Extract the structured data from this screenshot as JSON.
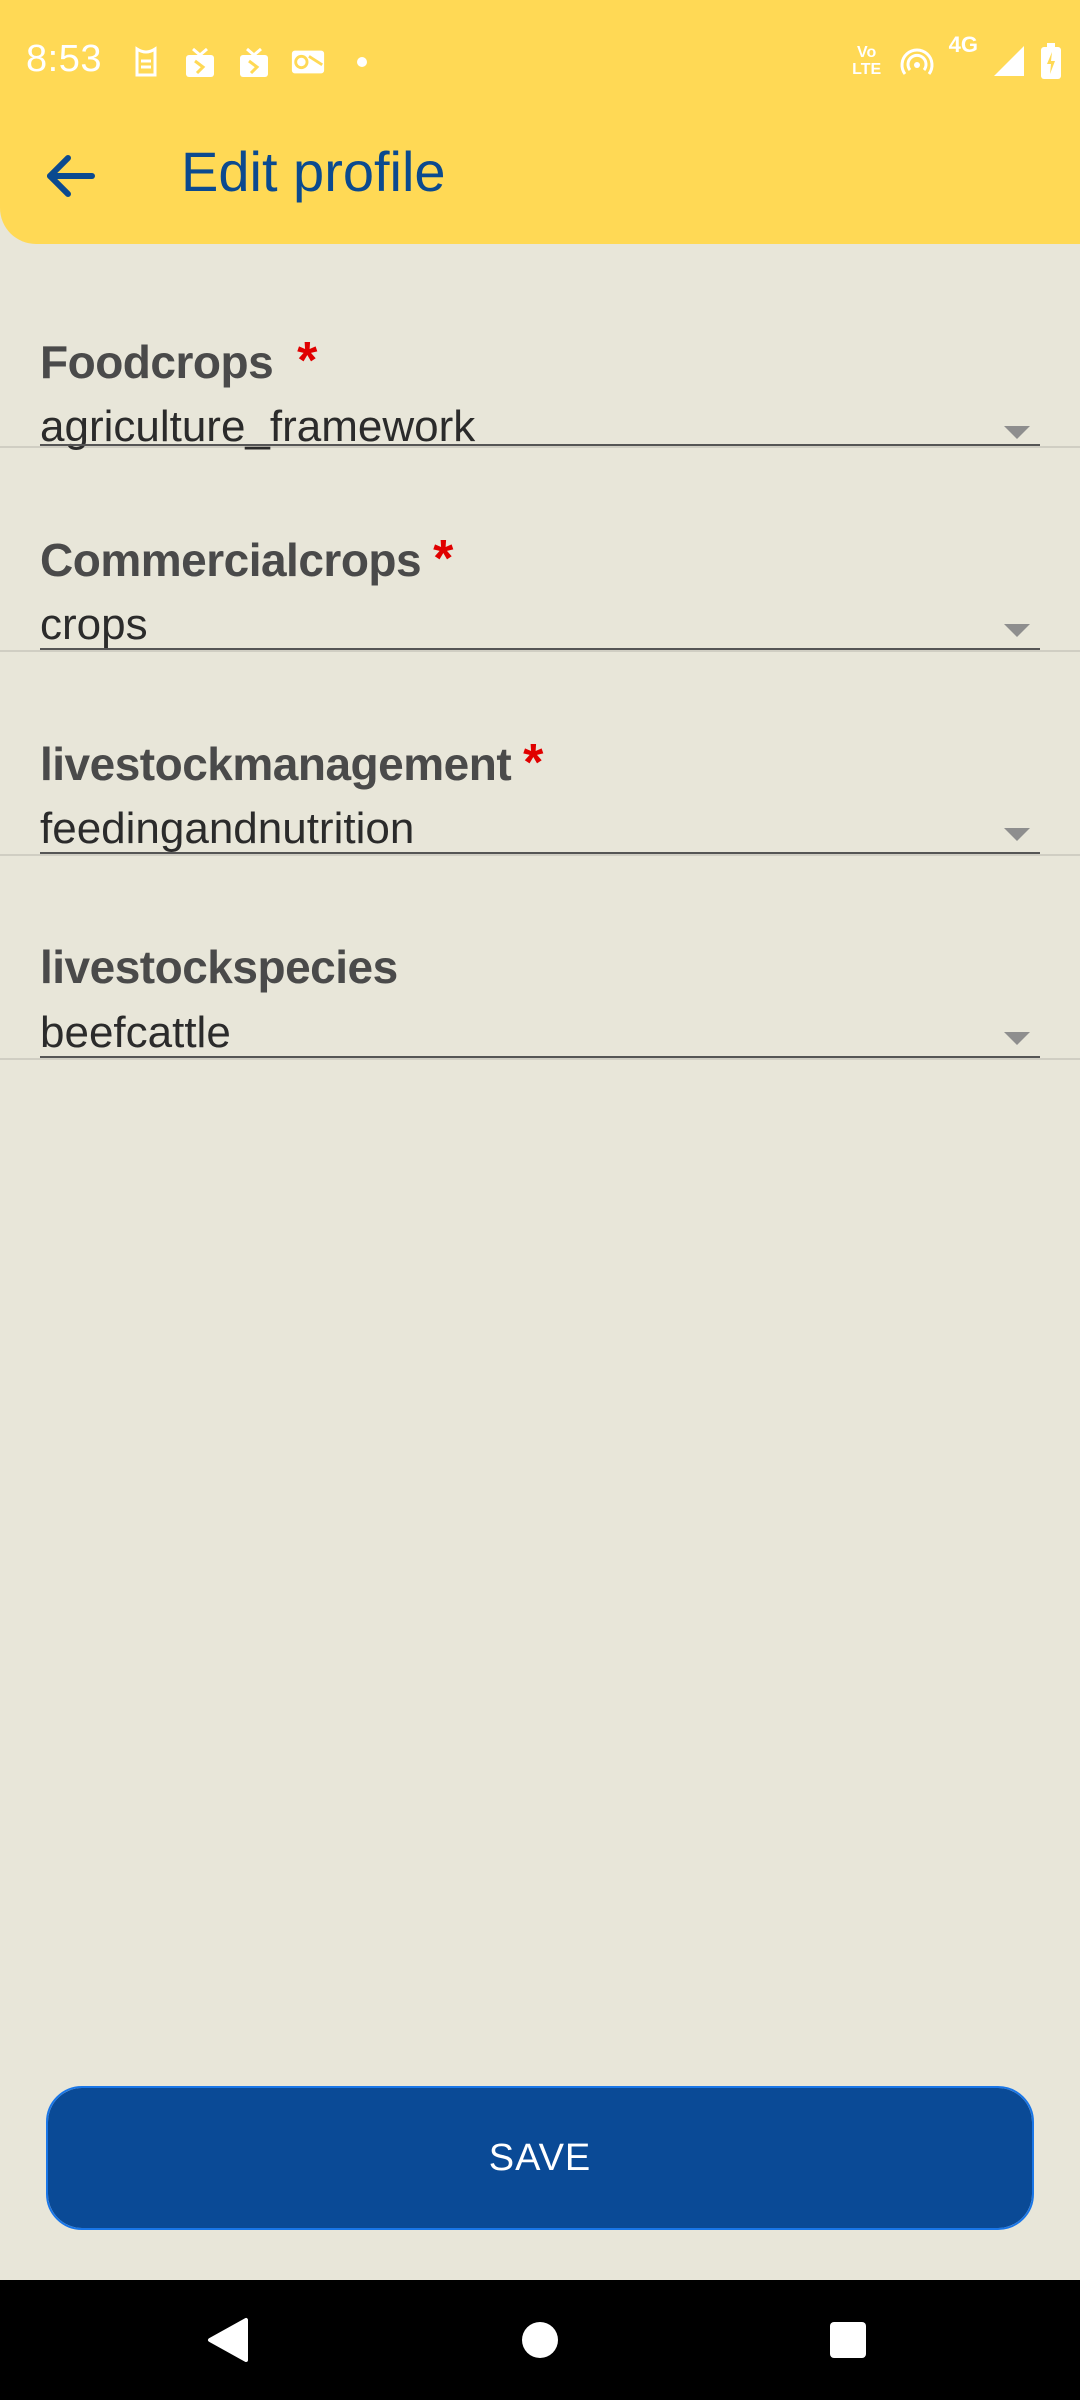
{
  "status_bar": {
    "time": "8:53",
    "volte_text": "Vo LTE",
    "network_text": "4G",
    "left_icons": [
      "cat-notification-icon",
      "gift-icon",
      "gift-icon",
      "outlook-icon",
      "dot-icon"
    ],
    "right_icons": [
      "volte-icon",
      "hotspot-icon",
      "4g-icon",
      "signal-icon",
      "battery-icon"
    ]
  },
  "header": {
    "title": "Edit profile",
    "back_icon": "arrow-back-icon",
    "background_color": "#FFD955",
    "title_color": "#0B4A8F"
  },
  "form": {
    "fields": [
      {
        "label": "Foodcrops",
        "required": true,
        "value": "agriculture_framework"
      },
      {
        "label": "Commercialcrops",
        "required": true,
        "value": "crops"
      },
      {
        "label": "livestockmanagement",
        "required": true,
        "value": "feedingandnutrition"
      },
      {
        "label": "livestockspecies",
        "required": false,
        "value": "beefcattle"
      }
    ],
    "required_marker": "*",
    "required_color": "#E00000"
  },
  "save_button": {
    "label": "SAVE",
    "color": "#0A4A96"
  },
  "nav_bar": {
    "buttons": [
      "back-triangle-icon",
      "home-circle-icon",
      "recents-square-icon"
    ]
  }
}
